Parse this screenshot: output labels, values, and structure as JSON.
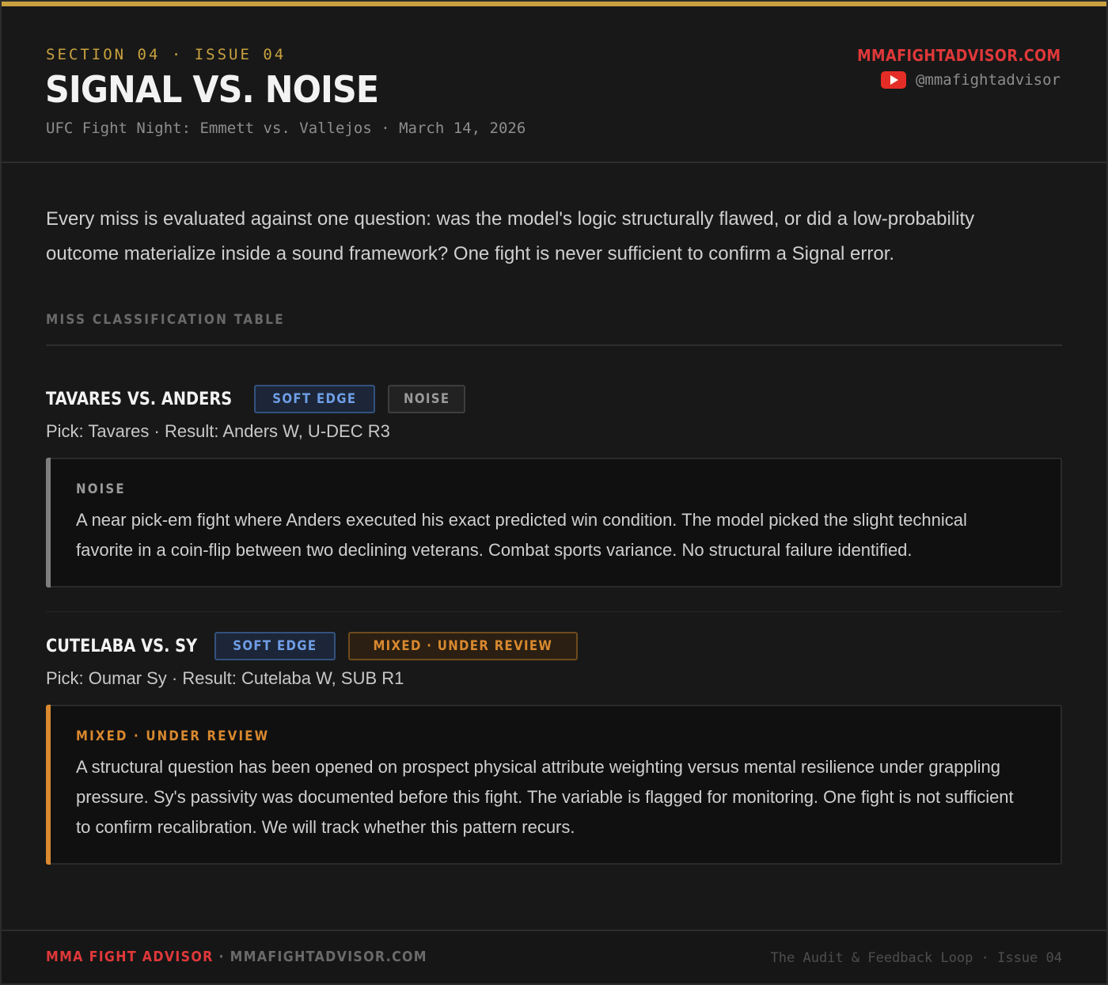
{
  "header": {
    "eyebrow": "SECTION 04 · ISSUE 04",
    "title": "SIGNAL VS. NOISE",
    "subtitle": "UFC Fight Night: Emmett vs. Vallejos · March 14, 2026",
    "brand_site": "MMAFIGHTADVISOR.COM",
    "handle": "@mmafightadvisor",
    "handle_icon": "youtube-icon"
  },
  "intro": "Every miss is evaluated against one question: was the model's logic structurally flawed, or did a low-probability outcome materialize inside a sound framework? One fight is never sufficient to confirm a Signal error.",
  "section_label": "MISS CLASSIFICATION TABLE",
  "entries": [
    {
      "title": "TAVARES VS. ANDERS",
      "tags": [
        "SOFT EDGE",
        "NOISE"
      ],
      "pick": "Pick: Tavares · Result: Anders W, U-DEC R3",
      "verdict_label": "NOISE",
      "verdict_text": "A near pick-em fight where Anders executed his exact predicted win condition. The model picked the slight technical favorite in a coin-flip between two declining veterans. Combat sports variance. No structural failure identified."
    },
    {
      "title": "CUTELABA VS. SY",
      "tags": [
        "SOFT EDGE",
        "MIXED · UNDER REVIEW"
      ],
      "pick": "Pick: Oumar Sy · Result: Cutelaba W, SUB R1",
      "verdict_label": "MIXED · UNDER REVIEW",
      "verdict_text": "A structural question has been opened on prospect physical attribute weighting versus mental resilience under grappling pressure. Sy's passivity was documented before this fight. The variable is flagged for monitoring. One fight is not sufficient to confirm recalibration. We will track whether this pattern recurs."
    }
  ],
  "footer": {
    "brand": "MMA FIGHT ADVISOR",
    "separator": " · ",
    "site": "MMAFIGHTADVISOR.COM",
    "right": "The Audit & Feedback Loop · Issue 04"
  },
  "colors": {
    "gold_accent": "#c9a23f",
    "brand_red": "#e0383a",
    "soft_edge_blue": "#6f9ee6",
    "mixed_orange": "#d9892f",
    "noise_grey": "#9a9a9a"
  }
}
